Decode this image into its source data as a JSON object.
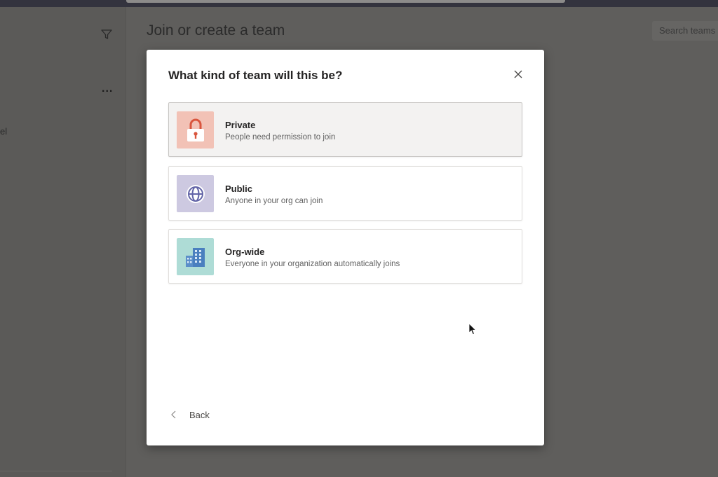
{
  "background": {
    "page_title": "Join or create a team",
    "search_placeholder": "Search teams",
    "rail_cut_label": "el",
    "more_glyph": "..."
  },
  "modal": {
    "title": "What kind of team will this be?",
    "close_icon": "close-icon",
    "options": [
      {
        "label": "Private",
        "description": "People need permission to join",
        "icon": "lock-icon",
        "icon_bg": "#f2c2b6",
        "selected": true
      },
      {
        "label": "Public",
        "description": "Anyone in your org can join",
        "icon": "globe-icon",
        "icon_bg": "#cdc9e1",
        "selected": false
      },
      {
        "label": "Org-wide",
        "description": "Everyone in your organization automatically joins",
        "icon": "building-icon",
        "icon_bg": "#aedcd6",
        "selected": false
      }
    ],
    "back_label": "Back"
  },
  "colors": {
    "overlay": "#5f5e5c",
    "modal_bg": "#ffffff",
    "selected_option_bg": "#f3f2f1",
    "text_primary": "#252424"
  }
}
